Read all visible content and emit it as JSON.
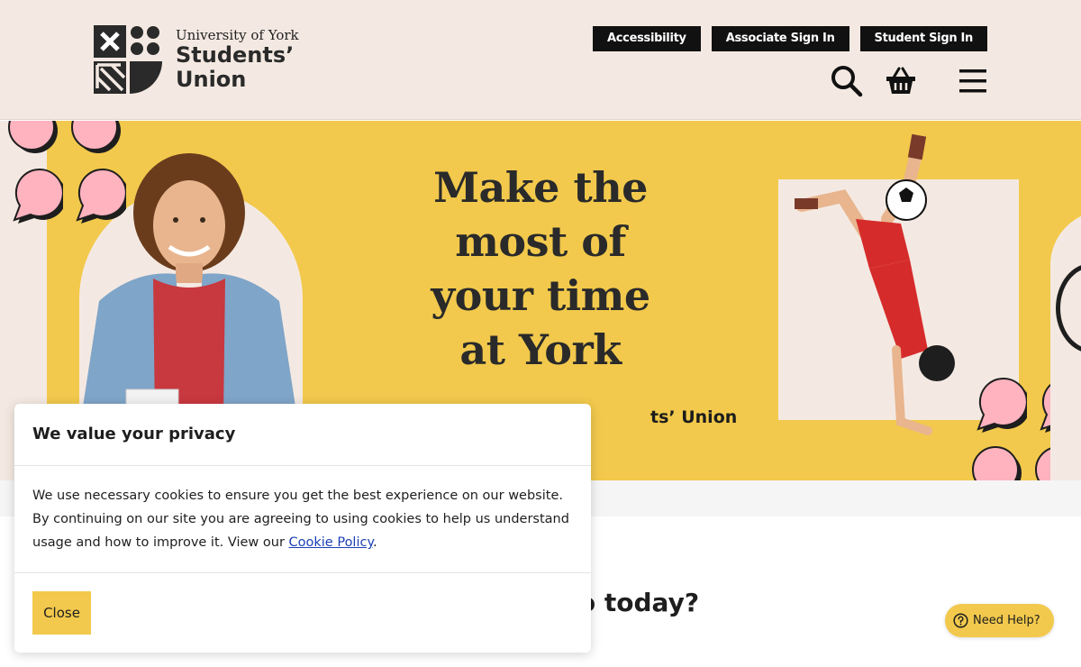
{
  "header": {
    "logo_university": "University of York",
    "logo_line1": "Students’",
    "logo_line2": "Union",
    "top_buttons": [
      "Accessibility",
      "Associate Sign In",
      "Student Sign In"
    ],
    "icons": [
      "search-icon",
      "basket-icon",
      "menu-icon"
    ]
  },
  "hero": {
    "title_lines": [
      "Make the",
      "most of",
      "your time",
      "at York"
    ],
    "subtitle_partial": "ts’ Union",
    "background_color": "#f2c94c"
  },
  "main": {
    "heading_partial": "o today?"
  },
  "cookie": {
    "title": "We value your privacy",
    "body": "We use necessary cookies to ensure you get the best experience on our website. By continuing on our site you are agreeing to using cookies to help us understand usage and how to improve it. View our ",
    "link_text": "Cookie Policy",
    "body_end": ".",
    "close_label": "Close"
  },
  "help": {
    "label": "Need Help?",
    "icon": "question-circle-icon"
  },
  "colors": {
    "header_bg": "#f4e9e2",
    "accent_yellow": "#f2c94c",
    "bubble_pink": "#ffb3bf",
    "dark": "#111111"
  }
}
